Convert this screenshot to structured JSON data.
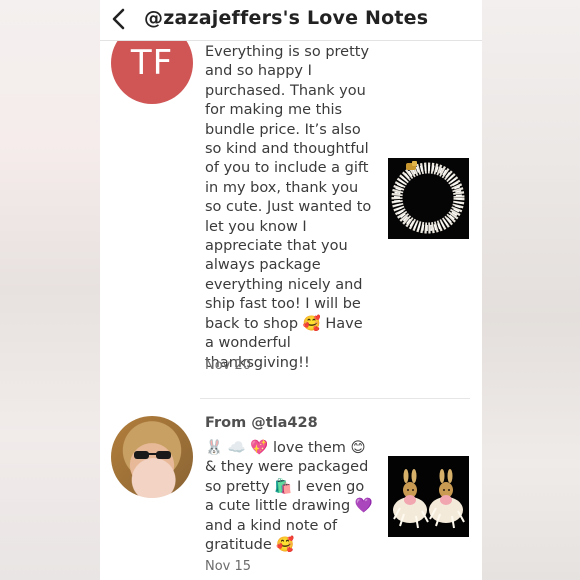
{
  "header": {
    "title": "@zazajeffers's Love Notes"
  },
  "notes": [
    {
      "avatar_initials": "TF",
      "message": "Everything is so pretty and so happy I purchased. Thank you for making me this bundle price. It’s also so kind and thoughtful of you to include a gift in my box, thank you so cute. Just wanted to let you know I appreciate that you always package everything nicely and ship fast too! I will be back to shop 🥰 Have a wonderful thanksgiving!!",
      "date": "Nov 20",
      "thumbnail_icon": "beaded-bracelet-image"
    },
    {
      "from": "From @tla428",
      "message": "🐰 ☁️ 💖 love them 😊 & they were packaged so pretty 🛍️ I even go a cute little drawing 💜 and a kind note of gratitude 🥰",
      "date": "Nov 15",
      "thumbnail_icon": "bunny-earrings-image"
    }
  ],
  "colors": {
    "avatar_initials_bg": "#d05656",
    "text": "#3b3b3b",
    "date": "#6b6b6b"
  }
}
